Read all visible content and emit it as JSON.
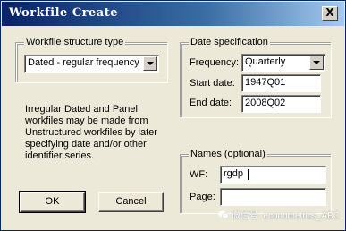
{
  "window": {
    "title": "Workfile Create",
    "close_symbol": "X"
  },
  "structure": {
    "legend": "Workfile structure type",
    "selected": "Dated - regular frequency"
  },
  "info": {
    "text": "Irregular Dated and Panel workfiles may be made from Unstructured workfiles by later specifying date and/or other identifier series."
  },
  "date_spec": {
    "legend": "Date specification",
    "frequency_label": "Frequency:",
    "frequency_value": "Quarterly",
    "start_label": "Start date:",
    "start_value": "1947Q01",
    "end_label": "End date:",
    "end_value": "2008Q02"
  },
  "names": {
    "legend": "Names (optional)",
    "wf_label": "WF:",
    "wf_value": "rgdp",
    "page_label": "Page:",
    "page_value": ""
  },
  "buttons": {
    "ok": "OK",
    "cancel": "Cancel"
  },
  "watermark": {
    "text": "微信号: econometrics_ABC"
  },
  "colors": {
    "title_bar": "#0a246a",
    "dialog_bg": "#ece9d8"
  }
}
